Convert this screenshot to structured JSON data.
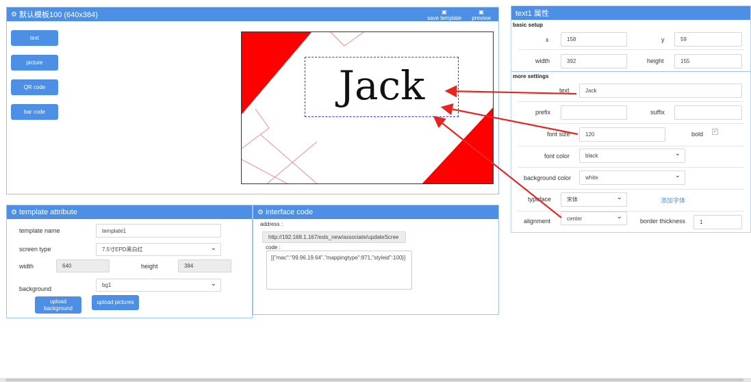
{
  "template_panel": {
    "title": "默认模板100 (640x384)",
    "save_template": "save template",
    "preview": "preview",
    "tools": [
      "text",
      "picture",
      "QR code",
      "bar code"
    ],
    "canvas_text": "Jack"
  },
  "attr_panel": {
    "title": "template attribute",
    "template_name_label": "template name",
    "template_name_value": "template1",
    "screen_type_label": "screen type",
    "screen_type_value": "7.5寸EPD黑白红",
    "width_label": "width",
    "width_value": "640",
    "height_label": "height",
    "height_value": "384",
    "background_label": "background",
    "background_value": "bg1",
    "upload_background": "upload background",
    "upload_pictures": "upload pictures"
  },
  "code_panel": {
    "title": "interface code",
    "address_label": "address :",
    "address_value": "http://192.168.1.167/esls_new/associate/updateScree",
    "code_label": "code :",
    "code_value": "[{\"mac\":\"99.96.19.64\",\"mappingtype\":871,\"styleid\":100}]"
  },
  "prop_panel": {
    "title": "text1 属性",
    "basic_setup": "basic setup",
    "x_label": "x",
    "x_value": "158",
    "y_label": "y",
    "y_value": "59",
    "width_label": "width",
    "width_value": "392",
    "height_label": "height",
    "height_value": "155",
    "more_settings": "more settings",
    "text_label": "text",
    "text_value": "Jack",
    "prefix_label": "prefix",
    "prefix_value": "",
    "suffix_label": "suffix",
    "suffix_value": "",
    "font_size_label": "font size",
    "font_size_value": "120",
    "bold_label": "bold",
    "font_color_label": "font color",
    "font_color_value": "black",
    "bg_color_label": "background color",
    "bg_color_value": "white",
    "typeface_label": "typeface",
    "typeface_value": "宋体",
    "add_font": "添加字体",
    "alignment_label": "alignment",
    "alignment_value": "center",
    "border_label": "border thickness",
    "border_value": "1"
  },
  "colors": {
    "accent": "#4e8fe6",
    "canvas_red": "#ff0000",
    "arrow_red": "#e8241f"
  }
}
